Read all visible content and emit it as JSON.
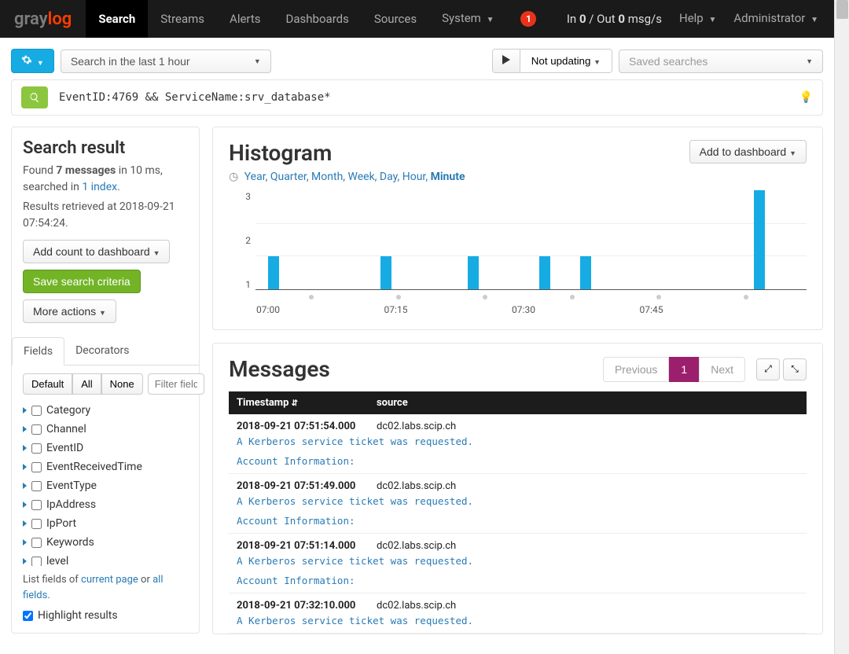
{
  "nav": {
    "brand_gray": "gray",
    "brand_accent": "log",
    "items": [
      "Search",
      "Streams",
      "Alerts",
      "Dashboards",
      "Sources",
      "System"
    ],
    "system_has_caret": true,
    "badge": "1",
    "io": "In 0 / Out 0 msg/s",
    "help": "Help",
    "admin": "Administrator"
  },
  "toolbar": {
    "time_range": "Search in the last 1 hour",
    "updating": "Not updating",
    "saved_placeholder": "Saved searches",
    "query": "EventID:4769 && ServiceName:srv_database*"
  },
  "sidebar": {
    "title": "Search result",
    "found_pre": "Found ",
    "found_bold": "7 messages",
    "found_post": " in 10 ms, searched in ",
    "index_link": "1 index",
    "retrieved": "Results retrieved at 2018-09-21 07:54:24.",
    "add_dash": "Add count to dashboard",
    "save_criteria": "Save search criteria",
    "more_actions": "More actions",
    "tab_fields": "Fields",
    "tab_decorators": "Decorators",
    "filter_default": "Default",
    "filter_all": "All",
    "filter_none": "None",
    "filter_placeholder": "Filter field",
    "fields": [
      "Category",
      "Channel",
      "EventID",
      "EventReceivedTime",
      "EventType",
      "IpAddress",
      "IpPort",
      "Keywords",
      "level"
    ],
    "list_note_pre": "List fields of ",
    "list_note_link1": "current page",
    "list_note_mid": " or ",
    "list_note_link2": "all fields",
    "highlight": "Highlight results"
  },
  "histogram": {
    "title": "Histogram",
    "add_dash": "Add to dashboard",
    "intervals": [
      "Year",
      "Quarter",
      "Month",
      "Week",
      "Day",
      "Hour",
      "Minute"
    ],
    "selected": "Minute",
    "yticks": [
      "3",
      "2",
      "1"
    ],
    "xticks": [
      "07:00",
      "07:15",
      "07:30",
      "07:45"
    ]
  },
  "chart_data": {
    "type": "bar",
    "title": "Histogram",
    "xlabel": "",
    "ylabel": "",
    "ylim": [
      0,
      3
    ],
    "x": [
      0,
      22,
      39,
      53,
      61,
      95
    ],
    "values": [
      1,
      1,
      1,
      1,
      1,
      3
    ],
    "x_tick_positions": [
      0,
      25,
      50,
      75
    ],
    "x_tick_labels": [
      "07:00",
      "07:15",
      "07:30",
      "07:45"
    ],
    "marker_positions": [
      8,
      25,
      42,
      59,
      76,
      93
    ]
  },
  "messages": {
    "title": "Messages",
    "prev": "Previous",
    "page": "1",
    "next": "Next",
    "th_ts": "Timestamp",
    "th_src": "source",
    "line1": "A Kerberos service ticket was requested.",
    "line2": "Account Information:",
    "rows": [
      {
        "ts": "2018-09-21 07:51:54.000",
        "src": "dc02.labs.scip.ch"
      },
      {
        "ts": "2018-09-21 07:51:49.000",
        "src": "dc02.labs.scip.ch"
      },
      {
        "ts": "2018-09-21 07:51:14.000",
        "src": "dc02.labs.scip.ch"
      },
      {
        "ts": "2018-09-21 07:32:10.000",
        "src": "dc02.labs.scip.ch"
      }
    ]
  }
}
